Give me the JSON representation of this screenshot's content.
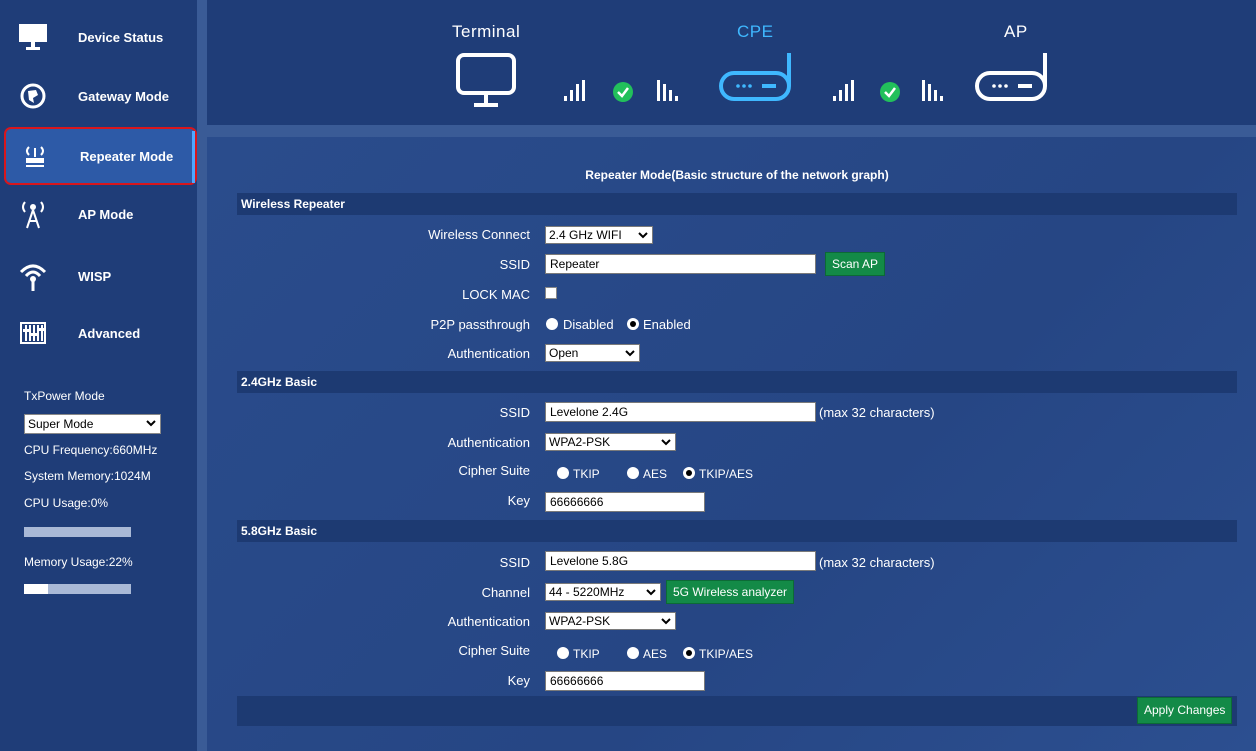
{
  "sidebar": {
    "items": [
      {
        "label": "Device Status",
        "icon": "monitor-icon"
      },
      {
        "label": "Gateway Mode",
        "icon": "globe-icon"
      },
      {
        "label": "Repeater Mode",
        "icon": "repeater-icon",
        "active": true
      },
      {
        "label": "AP Mode",
        "icon": "antenna-tower-icon"
      },
      {
        "label": "WISP",
        "icon": "wifi-icon"
      },
      {
        "label": "Advanced",
        "icon": "equalizer-icon"
      }
    ],
    "txpower_label": "TxPower Mode",
    "txpower_value": "Super Mode",
    "cpu_freq": "CPU Frequency:660MHz",
    "sys_mem": "System Memory:1024M",
    "cpu_usage": "CPU Usage:0%",
    "cpu_usage_value": 0,
    "mem_usage": "Memory Usage:22%",
    "mem_usage_value": 22
  },
  "header": {
    "terminal": "Terminal",
    "cpe": "CPE",
    "ap": "AP",
    "colors": {
      "active": "#3fb8ff",
      "ok": "#22c05b"
    }
  },
  "main": {
    "title": "Repeater Mode(Basic structure of the network graph)",
    "wireless_repeater": {
      "section": "Wireless Repeater",
      "wireless_connect_label": "Wireless Connect",
      "wireless_connect_value": "2.4 GHz WIFI",
      "ssid_label": "SSID",
      "ssid_value": "Repeater",
      "scan_button": "Scan AP",
      "lock_mac_label": "LOCK MAC",
      "p2p_label": "P2P passthrough",
      "p2p_disabled": "Disabled",
      "p2p_enabled": "Enabled",
      "auth_label": "Authentication",
      "auth_value": "Open"
    },
    "basic24": {
      "section": "2.4GHz Basic",
      "ssid_label": "SSID",
      "ssid_value": "Levelone 2.4G",
      "ssid_note": "(max 32 characters)",
      "auth_label": "Authentication",
      "auth_value": "WPA2-PSK",
      "cipher_label": "Cipher Suite",
      "tkip": "TKIP",
      "aes": "AES",
      "tkipaes": "TKIP/AES",
      "key_label": "Key",
      "key_value": "66666666"
    },
    "basic58": {
      "section": "5.8GHz Basic",
      "ssid_label": "SSID",
      "ssid_value": "Levelone 5.8G",
      "ssid_note": "(max 32 characters)",
      "channel_label": "Channel",
      "channel_value": "44 - 5220MHz",
      "analyzer_button": "5G Wireless analyzer",
      "auth_label": "Authentication",
      "auth_value": "WPA2-PSK",
      "cipher_label": "Cipher Suite",
      "tkip": "TKIP",
      "aes": "AES",
      "tkipaes": "TKIP/AES",
      "key_label": "Key",
      "key_value": "66666666"
    },
    "apply_button": "Apply Changes"
  }
}
